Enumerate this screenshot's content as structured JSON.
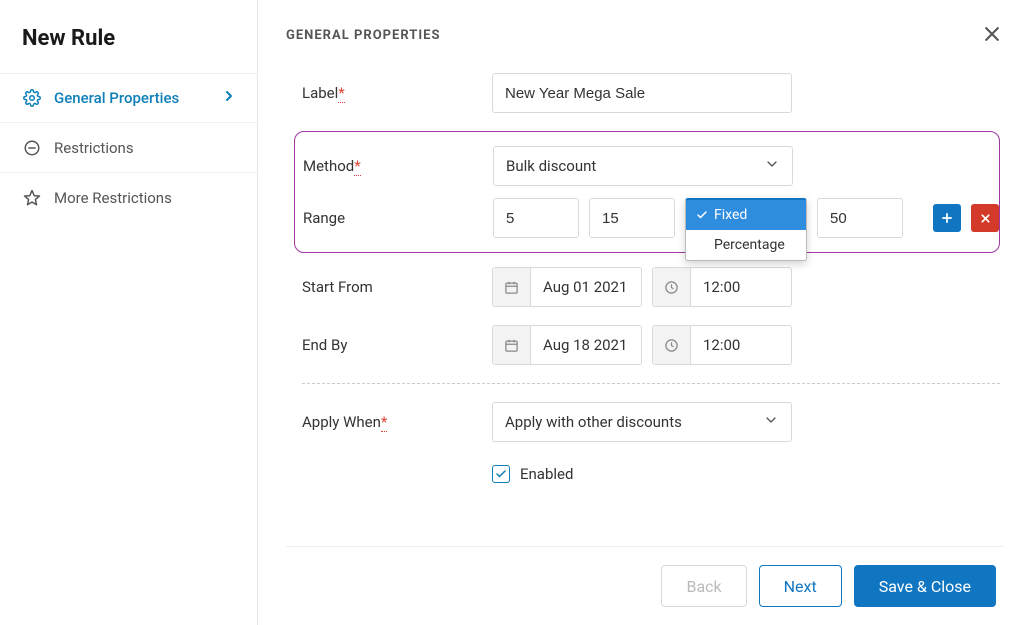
{
  "sidebar": {
    "title": "New Rule",
    "items": [
      {
        "label": "General Properties",
        "icon": "gear-icon",
        "active": true
      },
      {
        "label": "Restrictions",
        "icon": "minus-circle-icon",
        "active": false
      },
      {
        "label": "More Restrictions",
        "icon": "star-icon",
        "active": false
      }
    ]
  },
  "main": {
    "section_title": "GENERAL PROPERTIES",
    "labels": {
      "label": "Label",
      "method": "Method",
      "range": "Range",
      "start_from": "Start From",
      "end_by": "End By",
      "apply_when": "Apply When"
    },
    "values": {
      "label": "New Year Mega Sale",
      "method": "Bulk discount",
      "range_from": "5",
      "range_to": "15",
      "range_amount": "50",
      "start_date": "Aug 01 2021",
      "start_time": "12:00",
      "end_date": "Aug 18 2021",
      "end_time": "12:00",
      "apply_when": "Apply with other discounts",
      "enabled_label": "Enabled",
      "enabled_checked": true
    },
    "type_dropdown": {
      "options": [
        "Fixed",
        "Percentage"
      ],
      "selected": "Fixed"
    }
  },
  "footer": {
    "back": "Back",
    "next": "Next",
    "save": "Save & Close"
  }
}
